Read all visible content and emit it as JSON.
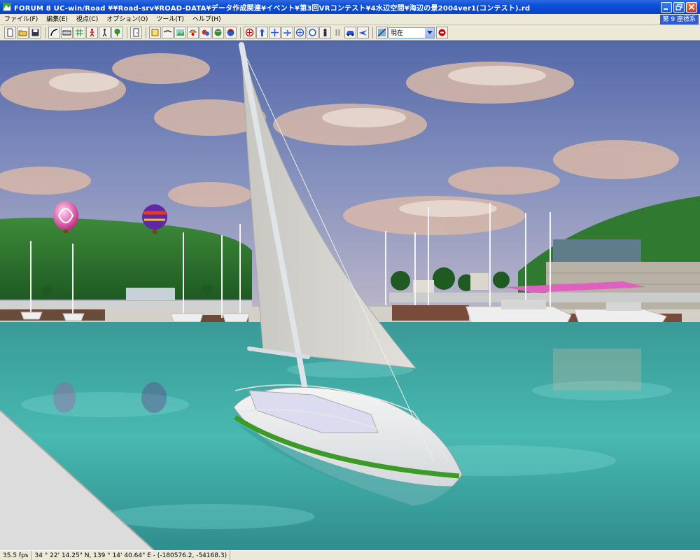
{
  "window": {
    "title": "FORUM 8    UC-win/Road    ¥¥Road-srv¥ROAD-DATA¥データ作成関連¥イベント¥第3回VRコンテスト¥4水辺空間¥海辺の景2004ver1(コンテスト).rd",
    "colors": {
      "titlebar": "#0b4fd8",
      "chrome": "#ece9d8",
      "close": "#c9401f"
    }
  },
  "menubar": {
    "items": [
      "ファイル(F)",
      "編集(E)",
      "視点(C)",
      "オプション(O)",
      "ツール(T)",
      "ヘルプ(H)"
    ],
    "coord_system": "第 9 座標系"
  },
  "toolbar": {
    "time_select_value": "現在",
    "icons": [
      "new-file-icon",
      "open-folder-icon",
      "save-icon",
      "road-curve-icon",
      "cross-section-icon",
      "terrain-grid-icon",
      "pedestrian-icon",
      "walker-icon",
      "tree-icon",
      "door-icon",
      "model-icon",
      "line-icon",
      "landscape-icon",
      "vehicle-icon",
      "object-icon",
      "map-icon",
      "rotate-icon",
      "move-up-icon",
      "move-cross-icon",
      "flight-icon",
      "navigate-icon",
      "zoom-icon",
      "person-icon",
      "pause-icon",
      "car-icon",
      "plane-icon",
      "sun-time-icon"
    ]
  },
  "statusbar": {
    "fps": "35.5 fps",
    "position": "34 °  22' 14.25\" N, 139 °  14' 40.64\" E  -  (-180576.2, -54168.3)"
  }
}
